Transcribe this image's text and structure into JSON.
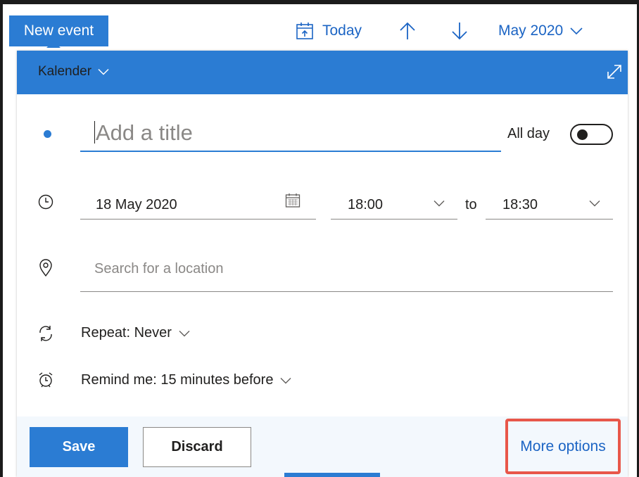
{
  "toolbar": {
    "new_event_label": "New event",
    "today_label": "Today",
    "month_label": "May 2020"
  },
  "panel": {
    "calendar_name": "Kalender",
    "title_placeholder": "Add a title",
    "all_day_label": "All day",
    "all_day_on": false,
    "date_value": "18 May 2020",
    "start_time": "18:00",
    "to_label": "to",
    "end_time": "18:30",
    "location_placeholder": "Search for a location",
    "repeat_label": "Repeat: Never",
    "remind_label": "Remind me: 15 minutes before"
  },
  "footer": {
    "save_label": "Save",
    "discard_label": "Discard",
    "more_options_label": "More options"
  },
  "colors": {
    "accent": "#2b7cd3",
    "link": "#1b64c4",
    "highlight": "#e8574a"
  }
}
